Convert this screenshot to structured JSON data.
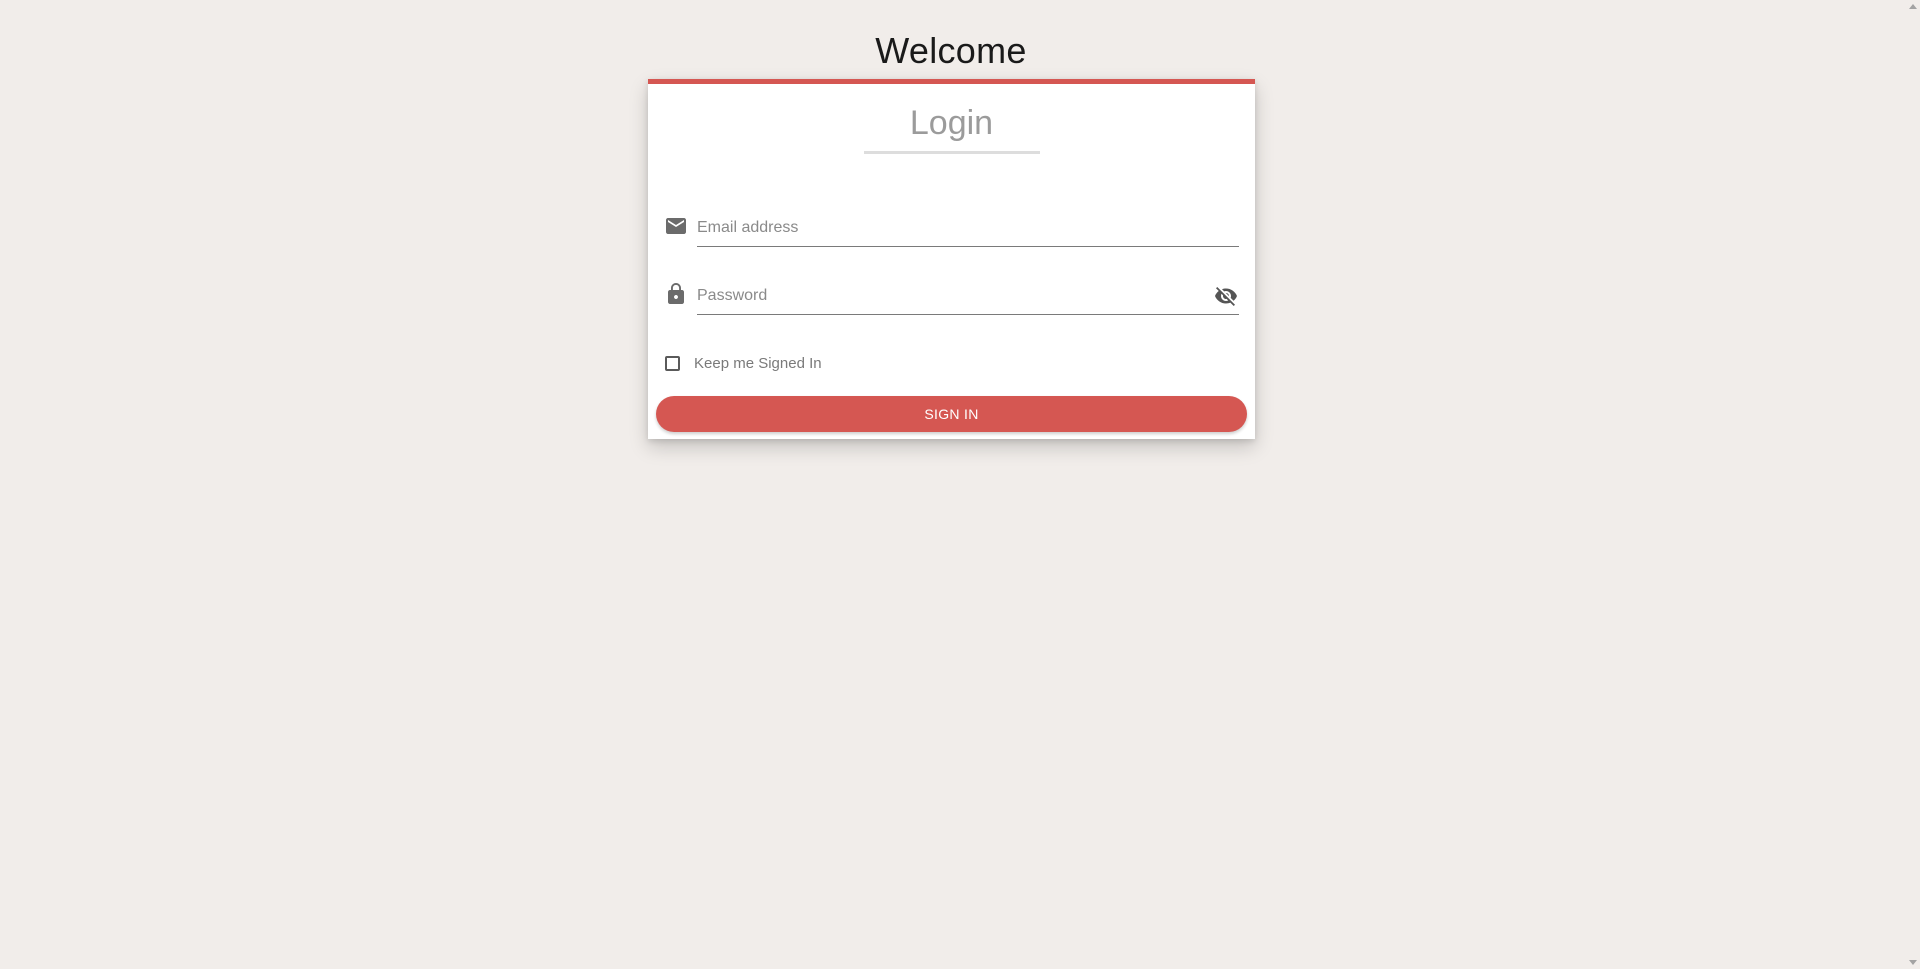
{
  "page": {
    "heading": "Welcome"
  },
  "login_card": {
    "title": "Login",
    "email": {
      "placeholder": "Email address",
      "value": "",
      "icon": "email-icon"
    },
    "password": {
      "placeholder": "Password",
      "value": "",
      "icon": "lock-icon",
      "toggle_icon": "visibility-off-icon"
    },
    "remember_me": {
      "label": "Keep me Signed In",
      "checked": false
    },
    "submit_label": "SIGN IN"
  },
  "colors": {
    "accent": "#d55752",
    "background": "#f1edea",
    "card": "#ffffff"
  }
}
